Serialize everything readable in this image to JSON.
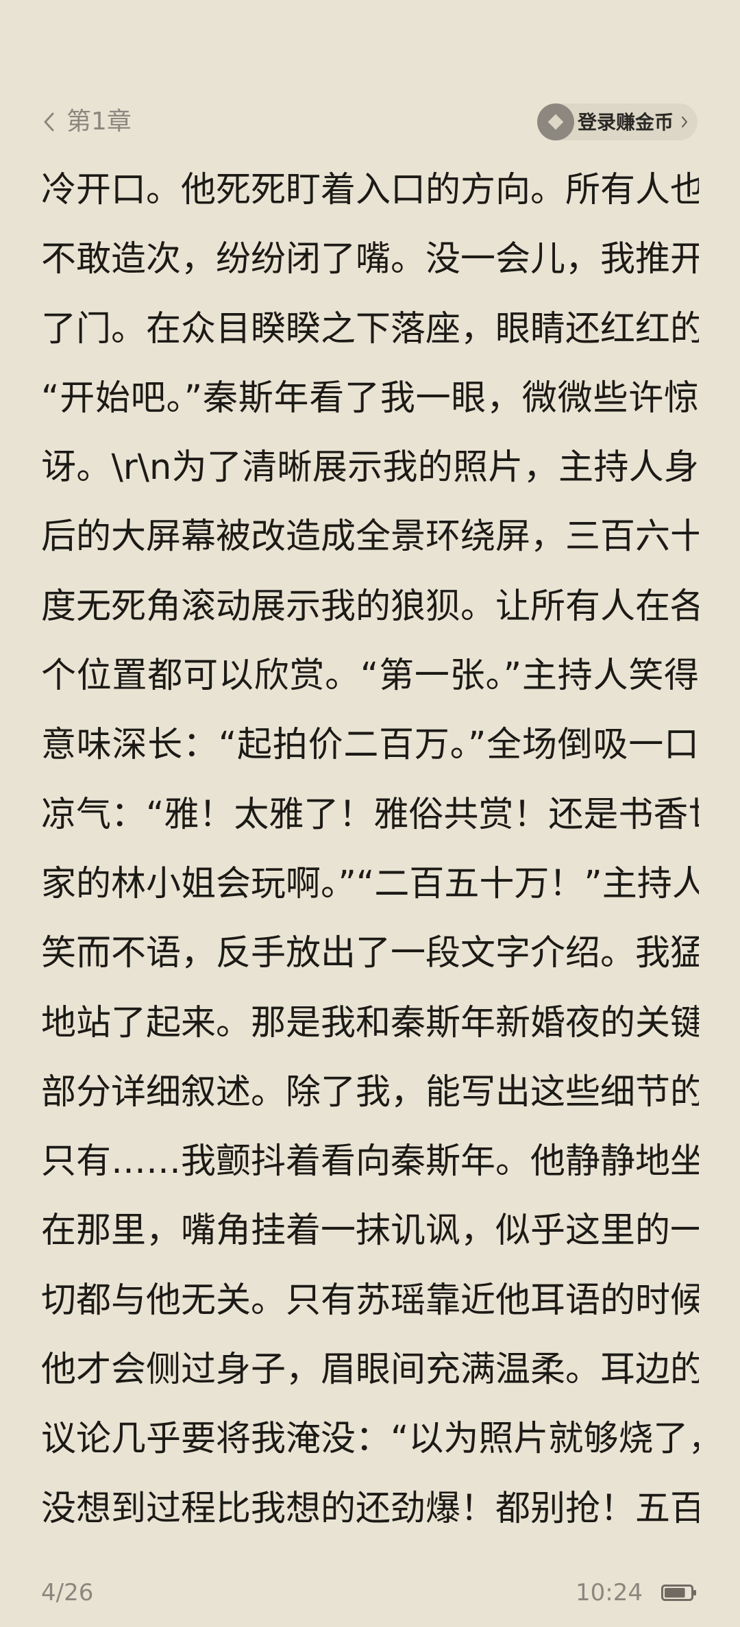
{
  "header": {
    "back_icon": "chevron-left-icon",
    "chapter_title": "第1章",
    "login_button": {
      "icon": "coin-diamond-icon",
      "label": "登录赚金币",
      "chevron_icon": "chevron-right-icon"
    }
  },
  "content": {
    "lines": [
      "冷开口。他死死盯着入口的方向。所有人也",
      "不敢造次，纷纷闭了嘴。没一会儿，我推开",
      "了门。在众目睽睽之下落座，眼睛还红红的：",
      "“开始吧。”秦斯年看了我一眼，微微些许惊",
      "讶。\\r\\n为了清晰展示我的照片，主持人身",
      "后的大屏幕被改造成全景环绕屏，三百六十",
      "度无死角滚动展示我的狼狈。让所有人在各",
      "个位置都可以欣赏。“第一张。”主持人笑得",
      "意味深长：“起拍价二百万。”全场倒吸一口",
      "凉气：“雅！太雅了！雅俗共赏！还是书香世",
      "家的林小姐会玩啊。”“二百五十万！”主持人",
      "笑而不语，反手放出了一段文字介绍。我猛",
      "地站了起来。那是我和秦斯年新婚夜的关键",
      "部分详细叙述。除了我，能写出这些细节的",
      "只有……我颤抖着看向秦斯年。他静静地坐",
      "在那里，嘴角挂着一抹讥讽，似乎这里的一",
      "切都与他无关。只有苏瑶靠近他耳语的时候，",
      "他才会侧过身子，眉眼间充满温柔。耳边的",
      "议论几乎要将我淹没：“以为照片就够烧了，",
      "没想到过程比我想的还劲爆！都别抢！五百"
    ]
  },
  "footer": {
    "page_indicator": "4/26",
    "time": "10:24",
    "battery_icon": "battery-icon",
    "battery_level": 0.8
  },
  "colors": {
    "background": "#e9e3d3",
    "text": "#1c1a16",
    "muted": "#8b877e",
    "pill_background": "#ddd7c7"
  }
}
